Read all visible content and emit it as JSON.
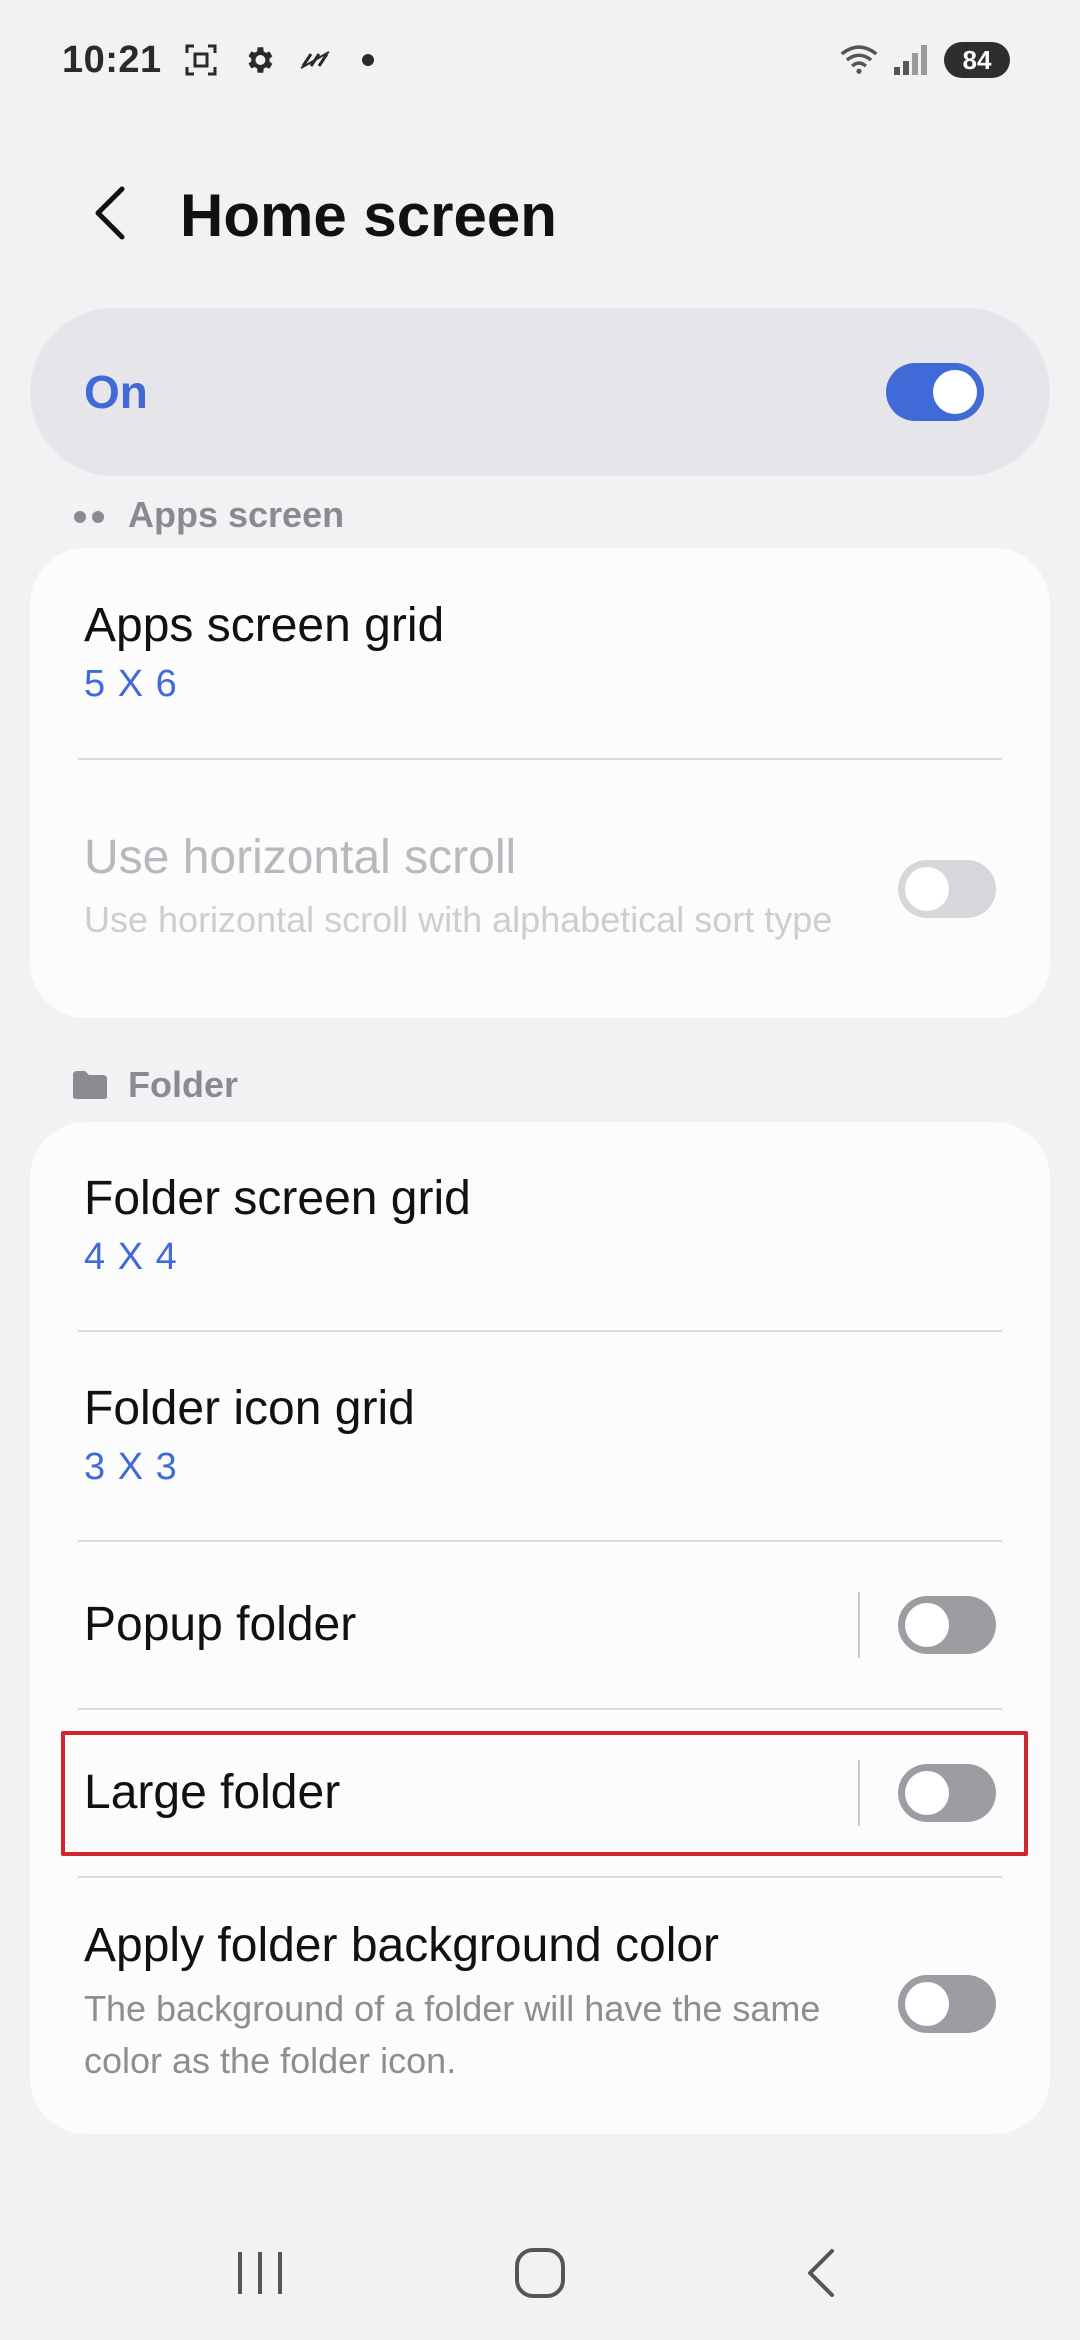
{
  "status_bar": {
    "time": "10:21",
    "icons": [
      "screenshot-icon",
      "settings-gear-icon",
      "no-data-icon",
      "dot-icon"
    ],
    "right_icons": [
      "wifi-icon",
      "signal-icon"
    ],
    "battery": "84"
  },
  "header": {
    "back_icon": "back-arrow-icon",
    "title": "Home screen"
  },
  "master": {
    "label": "On",
    "state": true,
    "accent": "#3f6ad8"
  },
  "apps_screen": {
    "section_title": "Apps screen",
    "section_icon": "apps-dots-icon",
    "items": [
      {
        "title": "Apps screen grid",
        "value": "5 X 6"
      },
      {
        "title": "Use horizontal scroll",
        "description": "Use horizontal scroll with alphabetical sort type",
        "state": false,
        "disabled": true
      }
    ]
  },
  "folder": {
    "section_title": "Folder",
    "section_icon": "folder-icon",
    "items": [
      {
        "title": "Folder screen grid",
        "value": "4 X 4"
      },
      {
        "title": "Folder icon grid",
        "value": "3 X 3"
      },
      {
        "title": "Popup folder",
        "state": false
      },
      {
        "title": "Large folder",
        "state": false,
        "highlighted": true
      },
      {
        "title": "Apply folder background color",
        "description": "The background of a folder will have the same color as the folder icon.",
        "state": false
      }
    ]
  },
  "nav": {
    "recents_icon": "recents-icon",
    "home_icon": "home-icon",
    "back_icon": "back-icon"
  },
  "colors": {
    "highlight": "#d1242f",
    "toggle_on": "#3f6ad8",
    "toggle_off": "#9c9ca3"
  }
}
